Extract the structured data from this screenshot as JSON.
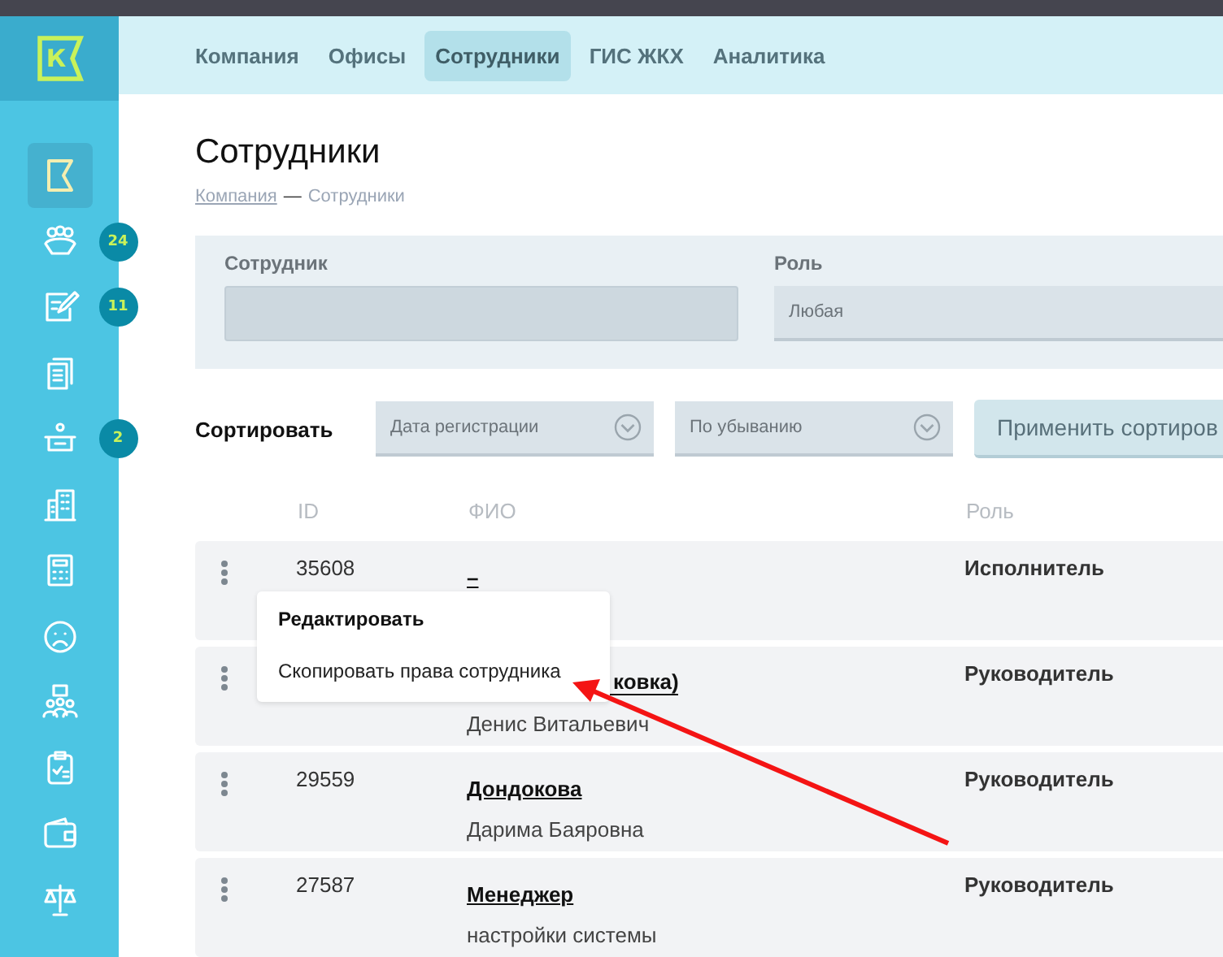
{
  "sidebar": {
    "logo": "К",
    "items": [
      {
        "selected": true
      },
      {
        "selected": false,
        "badge": "24"
      },
      {
        "selected": false,
        "badge": "11"
      },
      {
        "selected": false
      },
      {
        "selected": false,
        "badge": "2"
      },
      {
        "selected": false
      },
      {
        "selected": false
      },
      {
        "selected": false
      },
      {
        "selected": false
      },
      {
        "selected": false
      },
      {
        "selected": false
      },
      {
        "selected": false
      }
    ]
  },
  "nav": {
    "tabs": [
      {
        "label": "Компания",
        "selected": false
      },
      {
        "label": "Офисы",
        "selected": false
      },
      {
        "label": "Сотрудники",
        "selected": true
      },
      {
        "label": "ГИС ЖКХ",
        "selected": false
      },
      {
        "label": "Аналитика",
        "selected": false
      }
    ]
  },
  "page": {
    "title": "Сотрудники",
    "breadcrumb": {
      "link": "Компания",
      "separator": "—",
      "current": "Сотрудники"
    }
  },
  "filters": [
    {
      "label": "Сотрудник",
      "kind": "input"
    },
    {
      "label": "Роль",
      "kind": "select",
      "value": "Любая"
    }
  ],
  "sort": {
    "label": "Сортировать",
    "field": "Дата регистрации",
    "order": "По убыванию",
    "apply": "Применить сортиров"
  },
  "table": {
    "columns": [
      "ID",
      "ФИО",
      "Роль"
    ],
    "rows": [
      {
        "id": "35608",
        "name": "–",
        "role": "Исполнитель"
      },
      {
        "name_fragment": "ковка)",
        "subtitle": "Денис Витальевич",
        "role": "Руководитель"
      },
      {
        "id": "29559",
        "name": "Дондокова",
        "subtitle": "Дарима Баяровна",
        "role": "Руководитель"
      },
      {
        "id": "27587",
        "name": "Менеджер",
        "subtitle": "настройки системы",
        "role": "Руководитель"
      }
    ]
  },
  "context_menu": {
    "items": [
      {
        "label": "Редактировать",
        "bold": true
      },
      {
        "label": "Скопировать права сотрудника",
        "bold": false
      }
    ]
  }
}
